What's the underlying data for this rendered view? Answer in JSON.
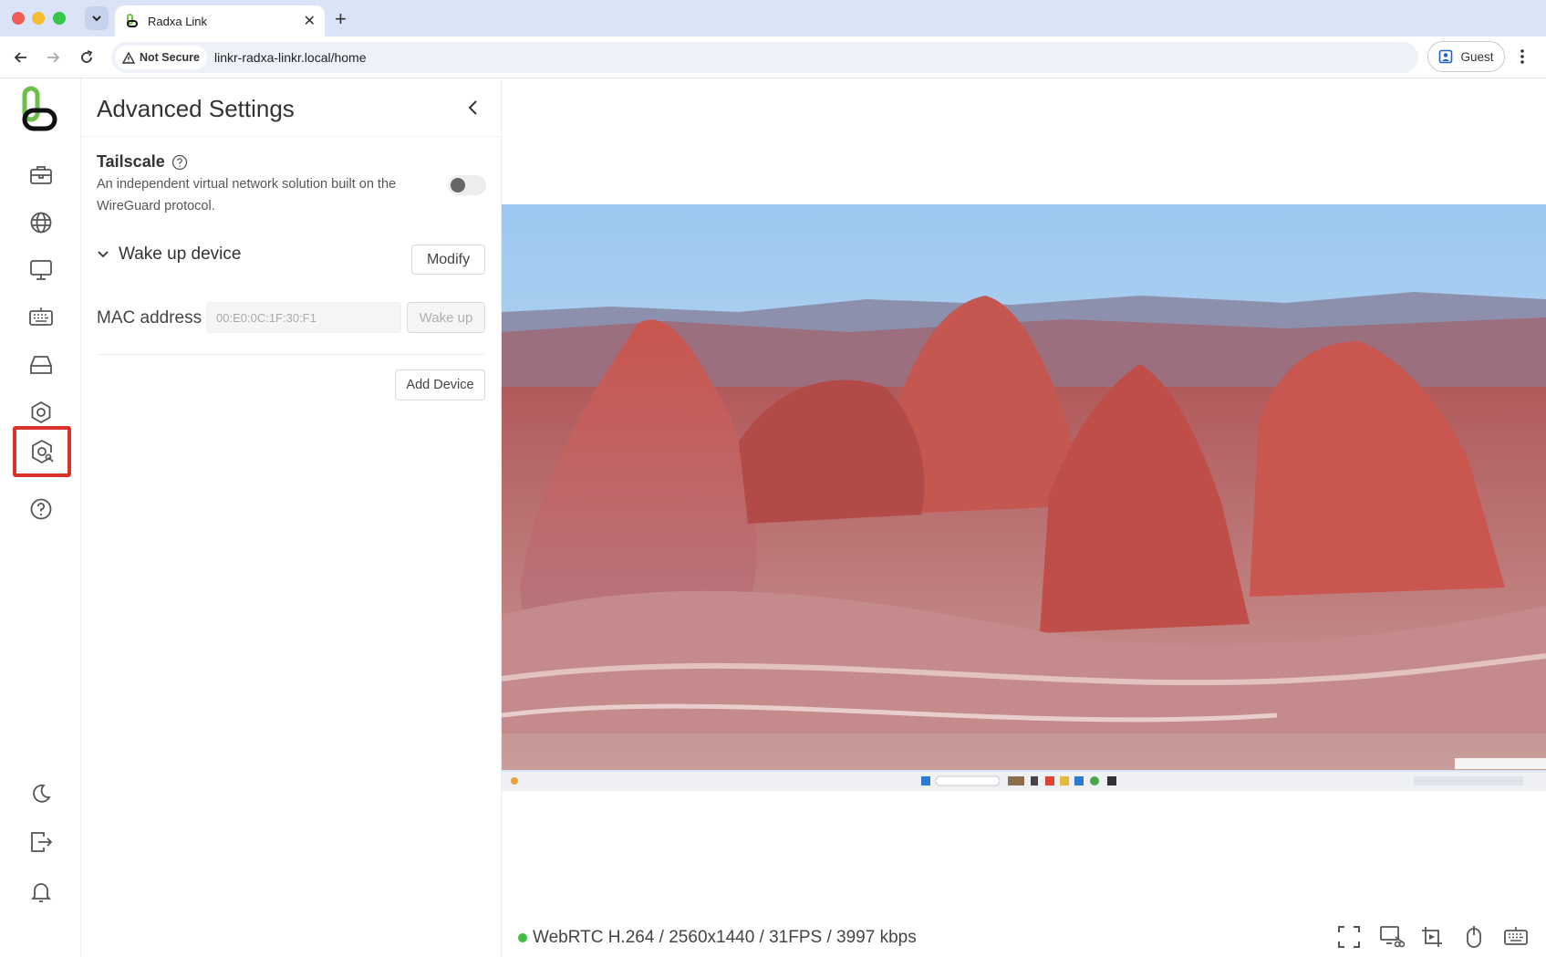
{
  "browser": {
    "tab_title": "Radxa Link",
    "security_label": "Not Secure",
    "url": "linkr-radxa-linkr.local/home",
    "profile_label": "Guest"
  },
  "sidebar": {
    "items": [
      {
        "name": "toolbox-icon"
      },
      {
        "name": "globe-icon"
      },
      {
        "name": "monitor-icon"
      },
      {
        "name": "keyboard-icon"
      },
      {
        "name": "drive-icon"
      },
      {
        "name": "settings-icon"
      },
      {
        "name": "advanced-settings-icon",
        "active": true
      },
      {
        "name": "help-icon"
      },
      {
        "name": "dark-mode-icon"
      },
      {
        "name": "logout-icon"
      },
      {
        "name": "bell-icon"
      }
    ],
    "active_highlight_color": "#d8322b"
  },
  "panel": {
    "title": "Advanced Settings",
    "tailscale": {
      "title": "Tailscale",
      "description": "An independent virtual network solution built on the WireGuard protocol.",
      "enabled": false
    },
    "wake": {
      "section_title": "Wake up device",
      "modify_label": "Modify",
      "mac_label": "MAC address",
      "mac_value": "00:E0:0C:1F:30:F1",
      "wake_label": "Wake up",
      "add_device_label": "Add Device"
    }
  },
  "viewer": {
    "status_text": "WebRTC H.264 / 2560x1440 / 31FPS / 3997 kbps",
    "status_color": "#3fbf3f",
    "tools": [
      "fullscreen-icon",
      "screenshot-icon",
      "record-icon",
      "mouse-icon",
      "keyboard-icon"
    ]
  }
}
